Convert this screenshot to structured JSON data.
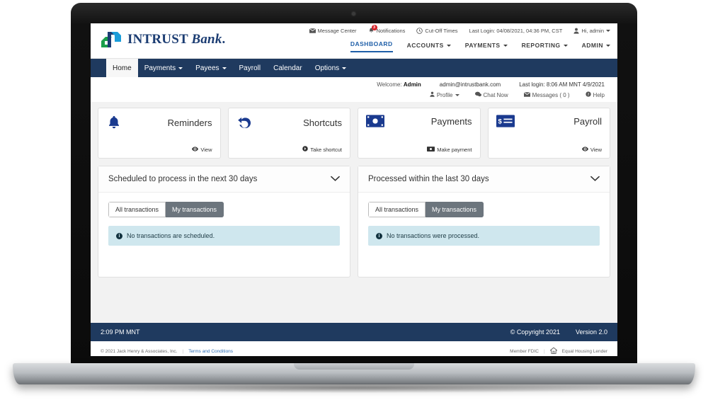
{
  "brand": {
    "name_bold": "INTRUST",
    "name_italic": "Bank",
    "name_dot": ".",
    "primary_navy": "#1f3a5f",
    "link_blue": "#1f5fa8",
    "logo_green": "#1a9e4b",
    "logo_teal": "#1b9dd9"
  },
  "utility_nav": [
    {
      "label": "Message Center",
      "icon": "envelope-icon"
    },
    {
      "label": "Notifications",
      "icon": "bell-icon",
      "badge": "3"
    },
    {
      "label": "Cut-Off Times",
      "icon": "clock-icon"
    },
    {
      "label": "Last Login: 04/08/2021, 04:36 PM, CST",
      "icon": "none"
    },
    {
      "label": "Hi, admin",
      "icon": "user-icon",
      "caret": true
    }
  ],
  "main_nav": [
    {
      "label": "DASHBOARD",
      "active": true,
      "caret": false
    },
    {
      "label": "ACCOUNTS",
      "active": false,
      "caret": true
    },
    {
      "label": "PAYMENTS",
      "active": false,
      "caret": true
    },
    {
      "label": "REPORTING",
      "active": false,
      "caret": true
    },
    {
      "label": "ADMIN",
      "active": false,
      "caret": true
    }
  ],
  "sub_nav": [
    {
      "label": "Home",
      "active": true,
      "caret": false
    },
    {
      "label": "Payments",
      "active": false,
      "caret": true
    },
    {
      "label": "Payees",
      "active": false,
      "caret": true
    },
    {
      "label": "Payroll",
      "active": false,
      "caret": false
    },
    {
      "label": "Calendar",
      "active": false,
      "caret": false
    },
    {
      "label": "Options",
      "active": false,
      "caret": true
    }
  ],
  "welcome": {
    "welcome_label": "Welcome:",
    "user_name": "Admin",
    "email": "admin@intrustbank.com",
    "last_login": "Last login: 8:06 AM MNT 4/9/2021",
    "actions": [
      {
        "label": "Profile",
        "icon": "user-icon",
        "caret": true
      },
      {
        "label": "Chat Now",
        "icon": "chat-icon",
        "caret": false
      },
      {
        "label": "Messages ( 0 )",
        "icon": "envelope-icon",
        "caret": false
      },
      {
        "label": "Help",
        "icon": "help-icon",
        "caret": false
      }
    ]
  },
  "cards": [
    {
      "title": "Reminders",
      "icon": "bell-icon",
      "action": "View",
      "action_icon": "eye-icon"
    },
    {
      "title": "Shortcuts",
      "icon": "undo-arrow-icon",
      "action": "Take shortcut",
      "action_icon": "arrow-circle-right-icon"
    },
    {
      "title": "Payments",
      "icon": "money-bill-icon",
      "action": "Make payment",
      "action_icon": "money-bill-icon"
    },
    {
      "title": "Payroll",
      "icon": "check-invoice-icon",
      "action": "View",
      "action_icon": "eye-icon"
    }
  ],
  "panels": [
    {
      "title": "Scheduled to process in the next 30 days",
      "toggle_icon": "chevron-down-icon",
      "tabs": [
        {
          "label": "All transactions",
          "active": false
        },
        {
          "label": "My transactions",
          "active": true
        }
      ],
      "alert": "No transactions are scheduled.",
      "alert_icon": "info-icon"
    },
    {
      "title": "Processed within the last 30 days",
      "toggle_icon": "chevron-down-icon",
      "tabs": [
        {
          "label": "All transactions",
          "active": false
        },
        {
          "label": "My transactions",
          "active": true
        }
      ],
      "alert": "No transactions were processed.",
      "alert_icon": "info-icon"
    }
  ],
  "app_footer": {
    "time": "2:09 PM MNT",
    "copyright": "© Copyright 2021",
    "version": "Version 2.0"
  },
  "page_footer": {
    "copyright": "© 2021 Jack Henry & Associates, Inc.",
    "terms_link": "Terms and Conditions",
    "member_fdic": "Member FDIC",
    "equal_housing": "Equal Housing Lender",
    "equal_housing_icon": "house-icon"
  }
}
